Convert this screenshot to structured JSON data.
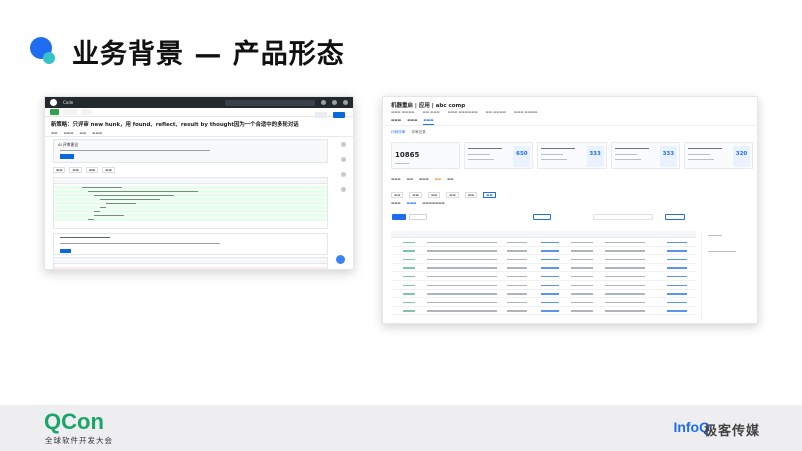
{
  "slide": {
    "title": "业务背景 — 产品形态"
  },
  "screenshot_left": {
    "top_brand": "Code",
    "pr_title": "新策略：只评审 new hunk，用 found、reflect、result by thought因为一个合适中的多轮对话",
    "ai_panel_title": "AI 评审建议"
  },
  "screenshot_right": {
    "page_title": "机器重启 | 应用 | abc comp",
    "tab_left": "代码评审",
    "tab_right": "评审记录",
    "cards": [
      "10865",
      "650",
      "333",
      "333",
      "320"
    ]
  },
  "footer": {
    "qcon_logo": "QCon",
    "qcon_subtitle": "全球软件开发大会",
    "infoq_logo": "InfoQ",
    "partner_name": "极客传媒"
  },
  "colors": {
    "primary_blue": "#1f6cf0",
    "accent_teal": "#34c3c9",
    "qcon_green": "#1aa56b"
  }
}
